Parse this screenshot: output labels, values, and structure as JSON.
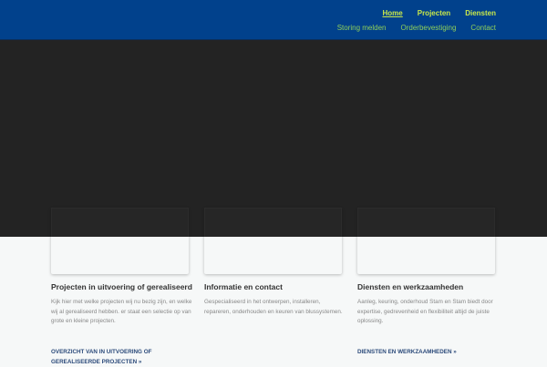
{
  "nav": {
    "primary": [
      {
        "label": "Home",
        "active": true
      },
      {
        "label": "Projecten"
      },
      {
        "label": "Diensten"
      }
    ],
    "secondary": [
      {
        "label": "Storing melden"
      },
      {
        "label": "Orderbevestiging"
      },
      {
        "label": "Contact"
      }
    ]
  },
  "columns": [
    {
      "title": "Projecten in uitvoering of gerealiseerd",
      "text": "Kijk hier met welke projecten wij nu bezig zijn, en welke wij al gerealiseerd hebben. er staat een selectie op van grote en kleine projecten.",
      "link": "OVERZICHT VAN IN UITVOERING OF GEREALISEERDE PROJECTEN »"
    },
    {
      "title": "Informatie en contact",
      "text": "Gespecialiseerd in het ontwerpen, installeren, repareren, onderhouden en keuren van blussystemen.",
      "link": ""
    },
    {
      "title": "Diensten en werkzaamheden",
      "text": "Aanleg, keuring, onderhoud Stam en Stam biedt door expertise, gedrevenheid en flexibiliteit altijd de juiste oplossing.",
      "link": "DIENSTEN EN WERKZAAMHEDEN »"
    }
  ],
  "colors": {
    "header": "#01418c",
    "nav_primary": "#c9e84a",
    "nav_secondary": "#8fcf5a",
    "hero": "#232323"
  }
}
